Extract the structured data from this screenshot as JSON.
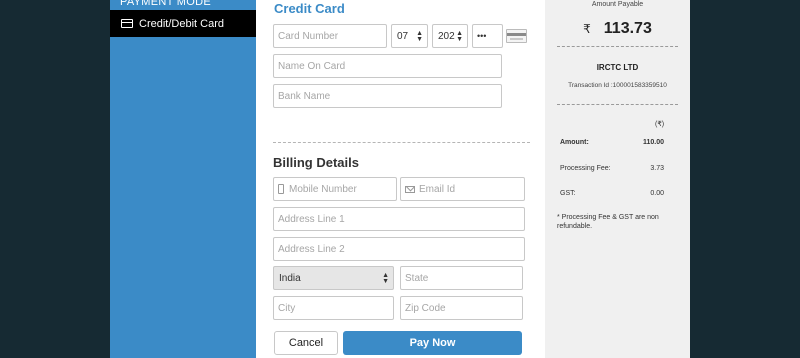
{
  "sidebar": {
    "title": "PAYMENT MODE",
    "items": [
      {
        "label": "Credit/Debit Card",
        "icon": "credit-card-icon",
        "selected": true
      }
    ]
  },
  "credit_card": {
    "title": "Credit Card",
    "card_number_placeholder": "Card Number",
    "expiry_month": "07",
    "expiry_year": "202",
    "cvv_value": "•••",
    "name_on_card_placeholder": "Name On Card",
    "bank_name_placeholder": "Bank Name"
  },
  "billing": {
    "title": "Billing Details",
    "mobile_placeholder": "Mobile Number",
    "email_placeholder": "Email Id",
    "address1_placeholder": "Address Line 1",
    "address2_placeholder": "Address Line 2",
    "country": "India",
    "state_placeholder": "State",
    "city_placeholder": "City",
    "zip_placeholder": "Zip Code"
  },
  "actions": {
    "cancel_label": "Cancel",
    "pay_label": "Pay Now"
  },
  "summary": {
    "amount_payable_label": "Amount Payable",
    "currency_symbol": "₹",
    "amount_payable": "113.73",
    "merchant": "IRCTC LTD",
    "transaction_id": "Transaction Id :100001583359510",
    "currency_header": "(₹)",
    "rows": [
      {
        "label": "Amount:",
        "value": "110.00"
      },
      {
        "label": "Processing Fee:",
        "value": "3.73"
      },
      {
        "label": "GST:",
        "value": "0.00"
      }
    ],
    "note": "* Processing Fee & GST are non refundable."
  },
  "colors": {
    "accent": "#3b8bc7",
    "sidebar_selected": "#000000",
    "background": "#162a33"
  }
}
